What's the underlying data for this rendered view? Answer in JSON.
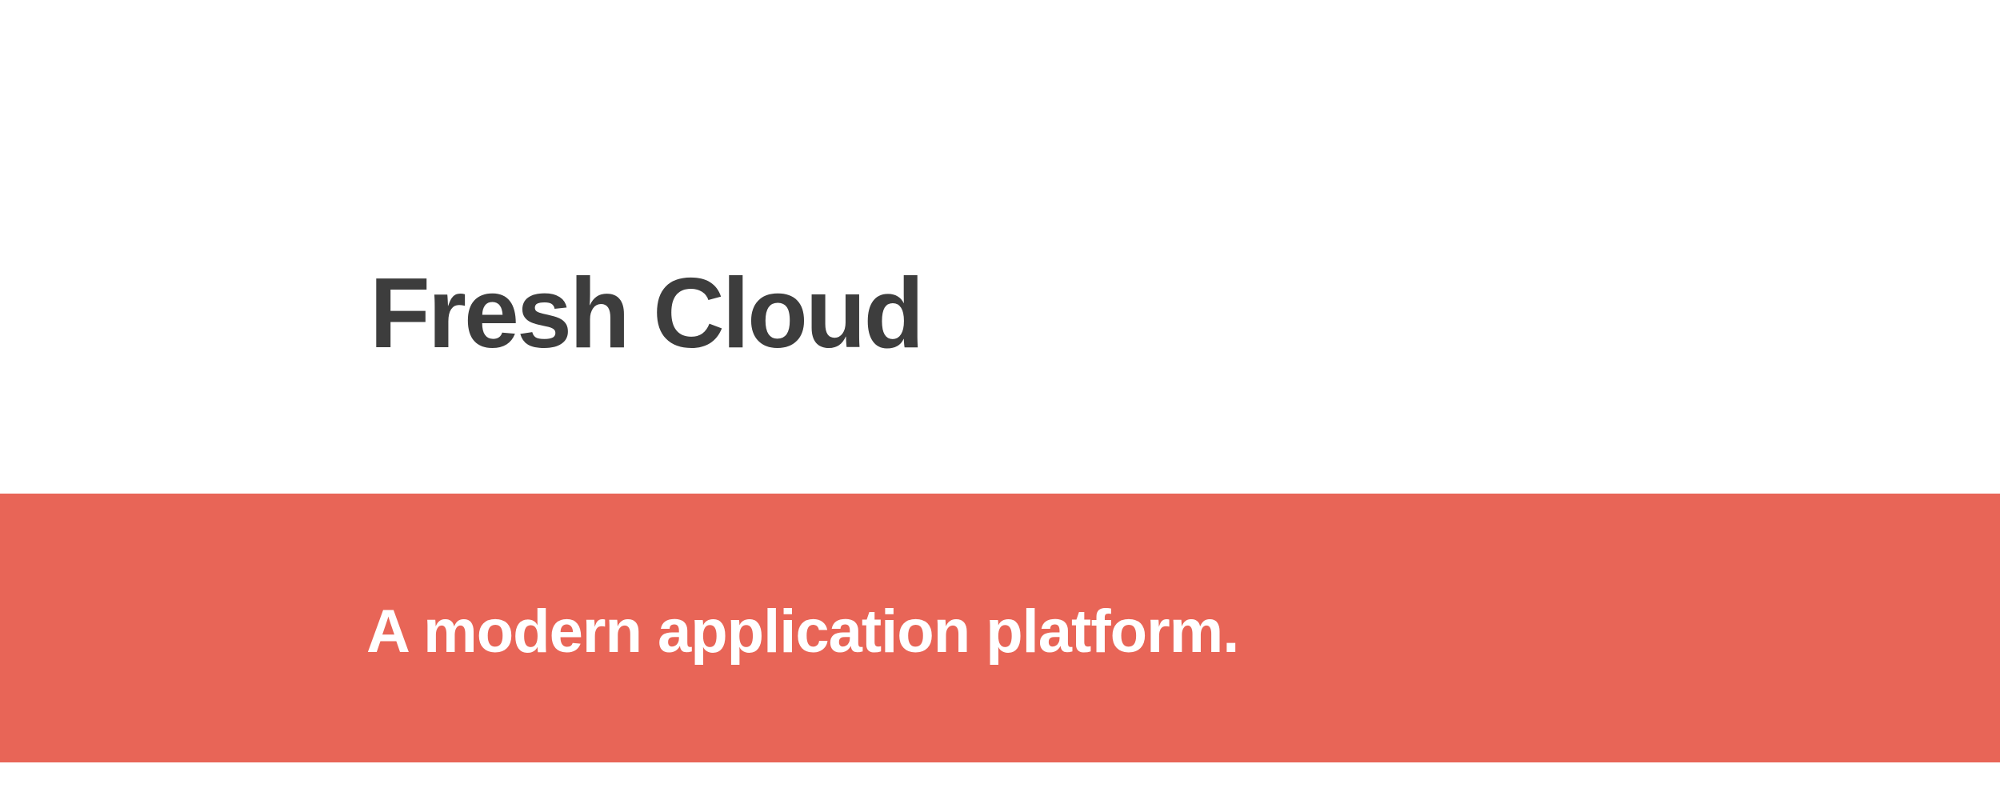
{
  "hero": {
    "title": "Fresh Cloud",
    "tagline": "A modern application platform."
  },
  "colors": {
    "background": "#ffffff",
    "title_text": "#3d3d3d",
    "band_background": "#e86557",
    "tagline_text": "#ffffff"
  }
}
